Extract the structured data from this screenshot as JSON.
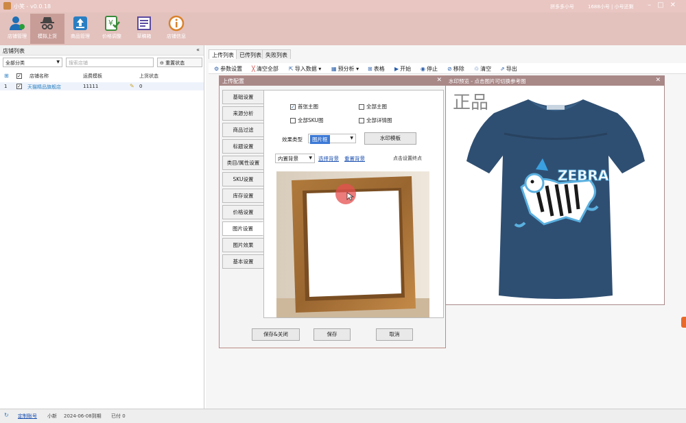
{
  "app": {
    "title": "小笑 - v0.0.18",
    "account": "拼多多小号",
    "balance": "1688小号 | 小号还剩"
  },
  "toolbar": {
    "items": [
      {
        "label": "店铺管理",
        "icon": "user-icon",
        "color": "#1e6fb5"
      },
      {
        "label": "模拟上货",
        "icon": "spy-icon",
        "color": "#444444"
      },
      {
        "label": "商品管理",
        "icon": "upload-box-icon",
        "color": "#2a7fc2"
      },
      {
        "label": "价格调整",
        "icon": "price-check-icon",
        "color": "#3a8a3a"
      },
      {
        "label": "草稿箱",
        "icon": "drafts-icon",
        "color": "#5a4aa0"
      },
      {
        "label": "店铺信息",
        "icon": "info-icon",
        "color": "#d9822b"
      }
    ]
  },
  "left_panel": {
    "title": "店铺列表",
    "collapse": "«",
    "filter": "全部分类",
    "search_placeholder": "搜索店铺",
    "reset_label": "重置状态",
    "columns": [
      "店铺名称",
      "运费模板",
      "上货状态"
    ],
    "rows": [
      {
        "index": "1",
        "name": "天猫精品旗舰店",
        "template": "11111",
        "status": "0"
      }
    ]
  },
  "tabs": [
    "上传列表",
    "已传列表",
    "失败列表"
  ],
  "actions": [
    {
      "label": "参数设置",
      "icon": "gear-icon",
      "glyph": "⚙"
    },
    {
      "label": "清空全部",
      "icon": "broom-icon",
      "glyph": "╳"
    },
    {
      "label": "导入数据 ▾",
      "icon": "import-icon",
      "glyph": "⇱"
    },
    {
      "label": "预分析 ▾",
      "icon": "analyze-icon",
      "glyph": "▦"
    },
    {
      "label": "表格",
      "icon": "table-icon",
      "glyph": "⊞"
    },
    {
      "label": "开始",
      "icon": "play-icon",
      "glyph": "▶"
    },
    {
      "label": "停止",
      "icon": "stop-icon",
      "glyph": "◉"
    },
    {
      "label": "移除",
      "icon": "remove-icon",
      "glyph": "⊘"
    },
    {
      "label": "清空",
      "icon": "clear-icon",
      "glyph": "♲"
    },
    {
      "label": "导出",
      "icon": "export-icon",
      "glyph": "⇗"
    }
  ],
  "dialog": {
    "title": "上传配置",
    "nav": [
      "基础设置",
      "来源分析",
      "商品过滤",
      "标题设置",
      "类目/属性设置",
      "SKU设置",
      "库存设置",
      "价格设置",
      "图片设置",
      "图片效果",
      "基本设置"
    ],
    "active_nav": "图片设置",
    "checks": [
      {
        "label": "首张主图",
        "checked": true
      },
      {
        "label": "全部主图",
        "checked": false
      },
      {
        "label": "全部SKU图",
        "checked": false
      },
      {
        "label": "全部详情图",
        "checked": false
      }
    ],
    "effect_label": "效果类型",
    "effect_value": "图片框",
    "watermark_button": "水印模板",
    "bg_select": "内置背景",
    "choose_bg": "选择背景",
    "reset_bg": "重置背景",
    "hint": "点击设置终点",
    "buttons": {
      "save_close": "保存&关闭",
      "save": "保存",
      "cancel": "取消"
    }
  },
  "watermark_preview": {
    "title": "水印预览 - 点击图片可切换参考图",
    "stamp": "正品",
    "shirt_text": "ZEBRA"
  },
  "statusbar": {
    "items": [
      "定制账号",
      "小新",
      "2024-06-08到期",
      "已付 0"
    ]
  }
}
